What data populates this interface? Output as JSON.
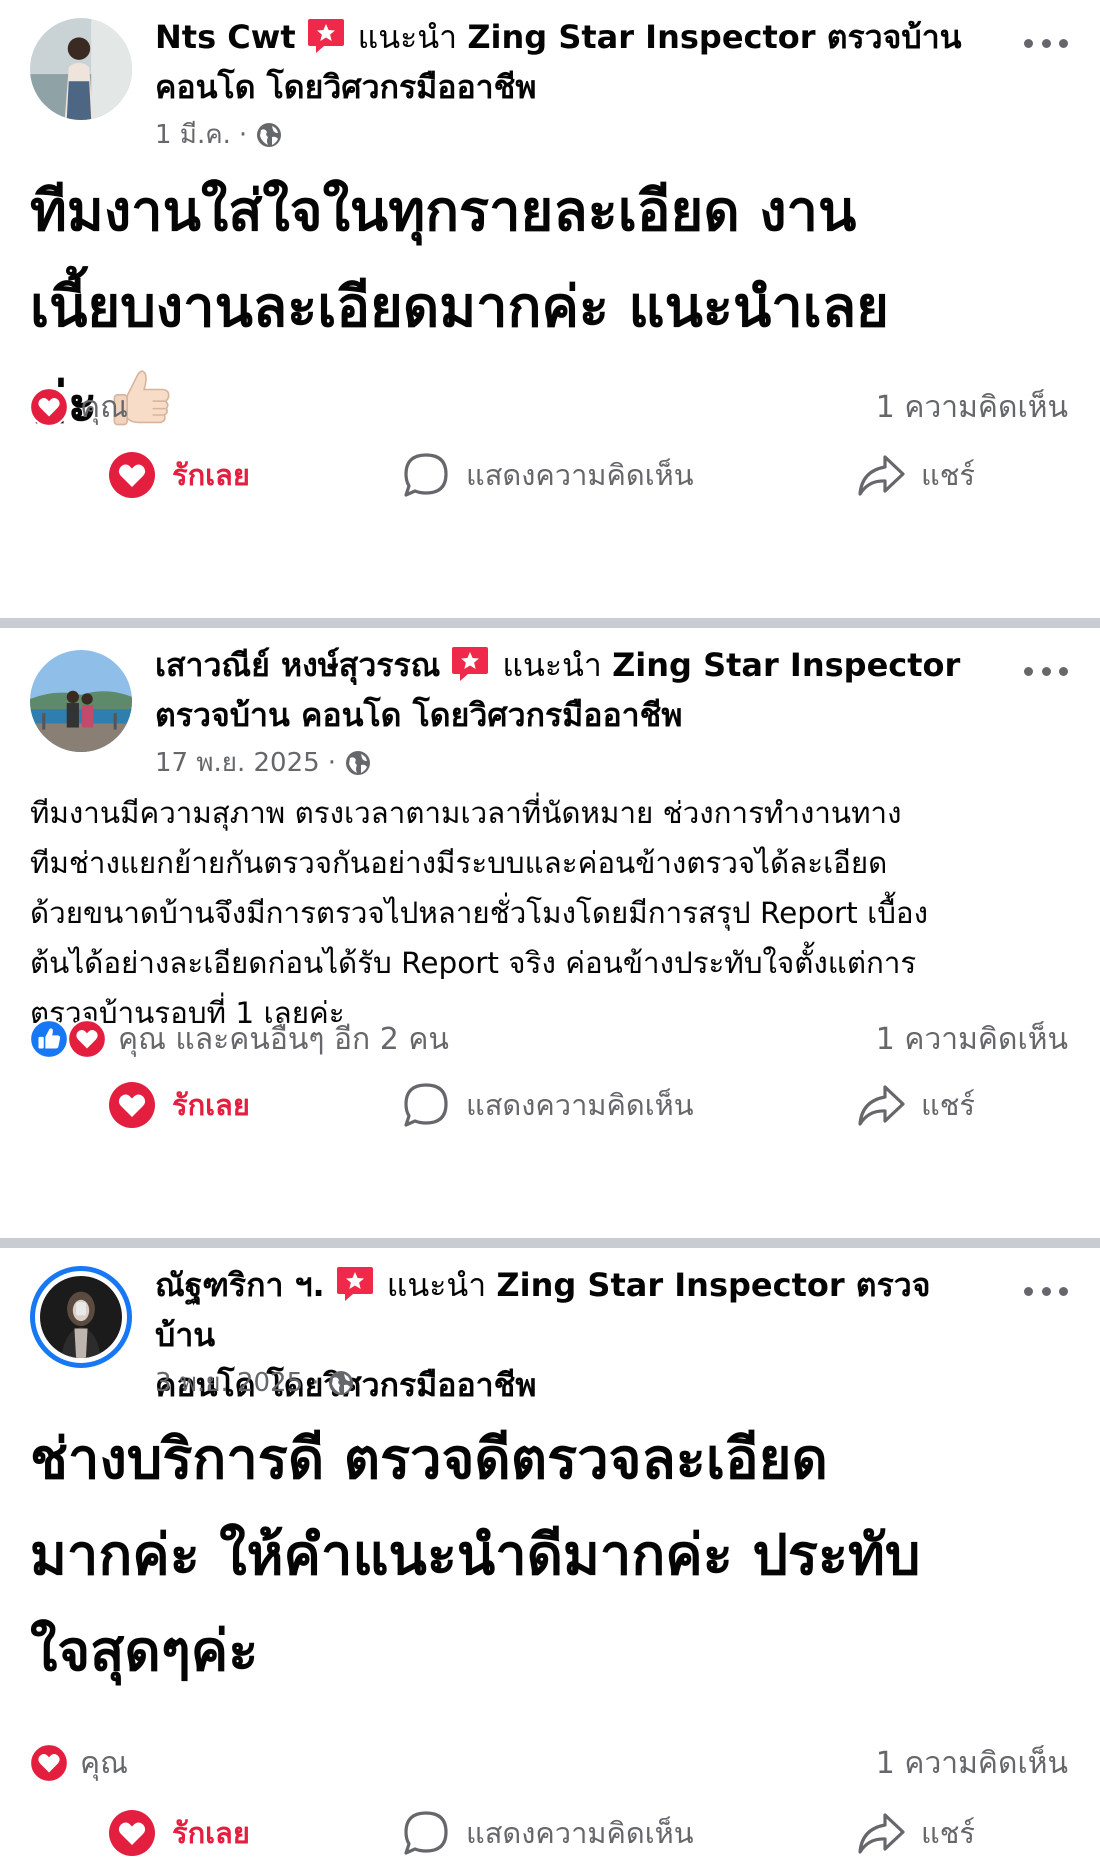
{
  "feed": {
    "posts": [
      {
        "author": "Nts Cwt",
        "recommends_prefix": "แนะนำ",
        "page_name_line1": "Zing Star Inspector ตรวจบ้าน",
        "page_name_line2": "คอนโด โดยวิศวกรมืออาชีพ",
        "date": "1 มี.ค.",
        "meta_separator": "·",
        "text_lines": [
          "ทีมงานใส่ใจในทุกรายละเอียด งาน",
          "เนี้ยบงานละเอียดมากค่ะ แนะนำเลย",
          "ค่ะ"
        ],
        "reactions_label": "คุณ",
        "comments_count": "1 ความคิดเห็น",
        "icons": [
          "love-reaction-icon",
          "thumbs-up-emoji"
        ]
      },
      {
        "author": "เสาวณีย์ หงษ์สุวรรณ",
        "recommends_prefix": "แนะนำ",
        "page_name_line1": "Zing Star Inspector",
        "page_name_line2": "ตรวจบ้าน คอนโด โดยวิศวกรมืออาชีพ",
        "date": "17 พ.ย. 2025",
        "meta_separator": "·",
        "text_lines": [
          "ทีมงานมีความสุภาพ ตรงเวลาตามเวลาที่นัดหมาย ช่วงการทำงานทาง",
          "ทีมช่างแยกย้ายกันตรวจกันอย่างมีระบบและค่อนข้างตรวจได้ละเอียด",
          "ด้วยขนาดบ้านจึงมีการตรวจไปหลายชั่วโมงโดยมีการสรุป Report เบื้อง",
          "ต้นได้อย่างละเอียดก่อนได้รับ Report จริง ค่อนข้างประทับใจตั้งแต่การ",
          "ตรวจบ้านรอบที่ 1 เลยค่ะ"
        ],
        "reactions_label": "คุณ และคนอื่นๆ อีก 2 คน",
        "comments_count": "1 ความคิดเห็น",
        "icons": [
          "like-reaction-icon",
          "love-reaction-icon"
        ]
      },
      {
        "author": "ณัฐฑริกา ฯ.",
        "recommends_prefix": "แนะนำ",
        "page_name_line1": "Zing Star Inspector ตรวจบ้าน",
        "page_name_line2": "คอนโด โดยวิศวกรมืออาชีพ",
        "date": "3 พ.ย. 2025",
        "meta_separator": "·",
        "text_lines": [
          "ช่างบริการดี ตรวจดีตรวจละเอียด",
          "มากค่ะ ให้คำแนะนำดีมากค่ะ ประทับ",
          "ใจสุดๆค่ะ"
        ],
        "reactions_label": "คุณ",
        "comments_count": "1 ความคิดเห็น",
        "icons": [
          "love-reaction-icon"
        ]
      }
    ]
  },
  "actions": {
    "love_label": "รักเลย",
    "comment_label": "แสดงความคิดเห็น",
    "share_label": "แชร์"
  },
  "colors": {
    "love_red": "#e41e3f",
    "like_blue": "#1877f2",
    "secondary_text": "#65676b",
    "separator": "#c9ccd1",
    "badge_red": "#f02849"
  }
}
